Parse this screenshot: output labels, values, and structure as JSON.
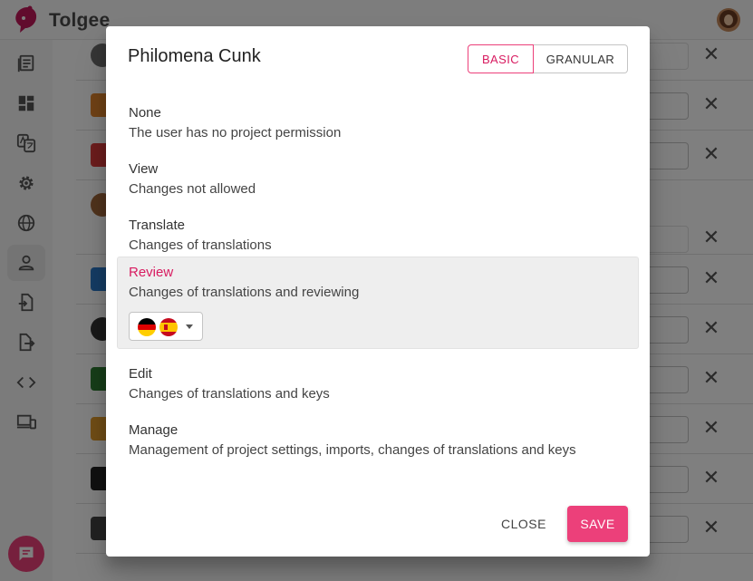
{
  "app": {
    "name": "Tolgee"
  },
  "colors": {
    "accent": "#ec407a",
    "accent_text": "#d81b60"
  },
  "nav": {
    "icons": [
      "translations-list-icon",
      "dashboard-icon",
      "translate-icon",
      "settings-icon",
      "languages-icon",
      "members-icon",
      "import-icon",
      "export-icon",
      "developer-icon",
      "integrate-icon"
    ],
    "active": "members-icon"
  },
  "dialog": {
    "title": "Philomena Cunk",
    "mode_tabs": {
      "basic": "BASIC",
      "granular": "GRANULAR",
      "selected": "basic"
    },
    "options": [
      {
        "name": "None",
        "description": "The user has no project permission"
      },
      {
        "name": "View",
        "description": "Changes not allowed"
      },
      {
        "name": "Translate",
        "description": "Changes of translations"
      },
      {
        "name": "Review",
        "description": "Changes of translations and reviewing"
      },
      {
        "name": "Edit",
        "description": "Changes of translations and keys"
      },
      {
        "name": "Manage",
        "description": "Management of project settings, imports, changes of translations and keys"
      }
    ],
    "selected_option": "Review",
    "review_languages": [
      "de-flag-icon",
      "es-flag-icon"
    ],
    "close_label": "CLOSE",
    "save_label": "SAVE"
  }
}
